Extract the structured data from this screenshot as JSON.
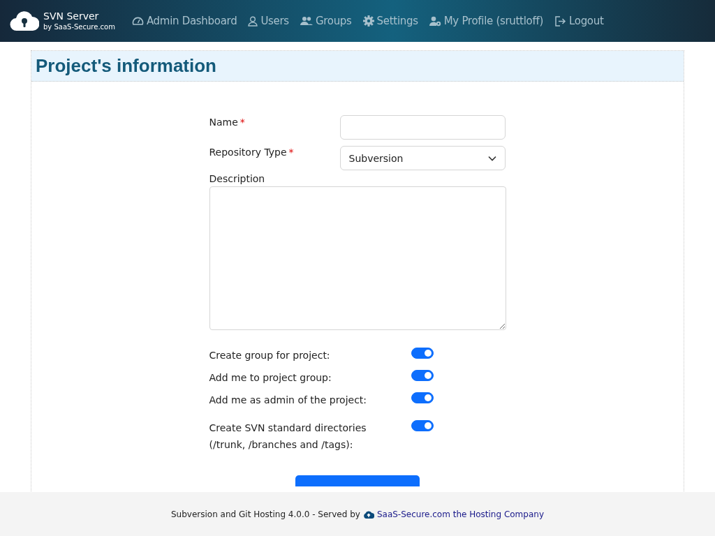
{
  "brand": {
    "title": "SVN Server",
    "subtitle": "by SaaS-Secure.com"
  },
  "nav": [
    {
      "label": "Admin Dashboard",
      "kind": "dashboard"
    },
    {
      "label": "Users",
      "kind": "user"
    },
    {
      "label": "Groups",
      "kind": "group"
    },
    {
      "label": "Settings",
      "kind": "gear"
    },
    {
      "label": "My Profile (sruttloff)",
      "kind": "profile"
    },
    {
      "label": "Logout",
      "kind": "logout"
    }
  ],
  "page_title": "Project's information",
  "fields": [
    {
      "label": "Name",
      "required_mark": "*",
      "kind": "text"
    },
    {
      "label": "Repository Type",
      "required_mark": "*",
      "kind": "select",
      "value": "Subversion"
    }
  ],
  "description": {
    "label": "Description"
  },
  "toggles": [
    {
      "label": "Create group for project:",
      "on": true
    },
    {
      "label": "Add me to project group:",
      "on": true
    },
    {
      "label": "Add me as admin of the project:",
      "on": true
    },
    {
      "label": "Create SVN standard directories (/trunk, /branches and /tags):",
      "on": true
    }
  ],
  "footer": {
    "text": "Subversion and Git Hosting 4.0.0 - Served by",
    "link": "SaaS-Secure.com the Hosting Company"
  }
}
